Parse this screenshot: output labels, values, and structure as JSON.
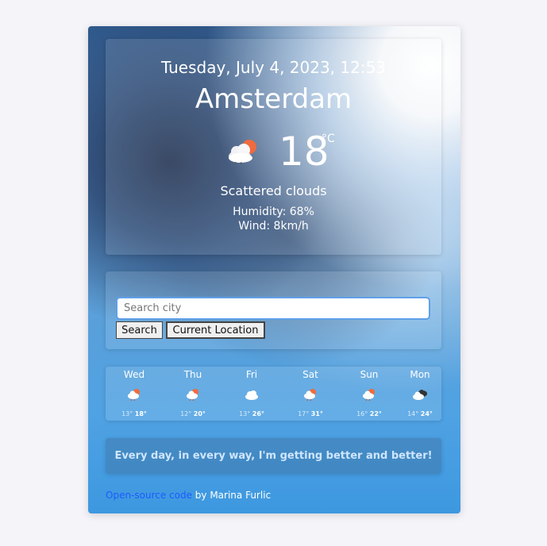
{
  "weather": {
    "datetime": "Tuesday, July 4, 2023, 12:53",
    "city": "Amsterdam",
    "temperature": "18",
    "unit": "°C",
    "condition_icon": "scattered-clouds-icon",
    "description": "Scattered clouds",
    "humidity": "Humidity: 68%",
    "wind": "Wind: 8km/h"
  },
  "search": {
    "placeholder": "Search city",
    "value": "",
    "search_label": "Search",
    "location_label": "Current Location"
  },
  "forecast": [
    {
      "day": "Wed",
      "min": "13°",
      "max": "18°",
      "icon": "rain-cloud-icon"
    },
    {
      "day": "Thu",
      "min": "12°",
      "max": "20°",
      "icon": "rain-cloud-icon"
    },
    {
      "day": "Fri",
      "min": "13°",
      "max": "26°",
      "icon": "cloud-icon"
    },
    {
      "day": "Sat",
      "min": "17°",
      "max": "31°",
      "icon": "rain-cloud-icon"
    },
    {
      "day": "Sun",
      "min": "16°",
      "max": "22°",
      "icon": "rain-cloud-icon"
    },
    {
      "day": "Mon",
      "min": "14°",
      "max": "24°",
      "icon": "broken-clouds-icon"
    }
  ],
  "quote": "Every day, in every way, I'm getting better and better!",
  "footer": {
    "link_text": "Open-source code",
    "author_text": " by Marina Furlic"
  },
  "colors": {
    "page_background": "#f4f4f9",
    "link": "#1b5cff",
    "input_border": "#5fa0e8",
    "quote_text": "#cfe6ff"
  }
}
